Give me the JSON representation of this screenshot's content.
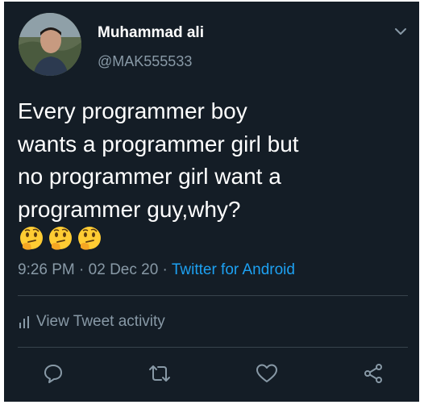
{
  "tweet": {
    "display_name": "Muhammad ali",
    "handle": "@MAK555533",
    "text_lines": [
      "Every programmer boy",
      "wants a programmer girl but",
      "no programmer girl want a",
      "programmer guy,why?"
    ],
    "emojis": [
      "thinking-face",
      "thinking-face",
      "thinking-face"
    ],
    "time": "9:26 PM",
    "separator": " · ",
    "date": "02 Dec 20",
    "source": "Twitter for Android",
    "activity_label": "View Tweet activity"
  },
  "colors": {
    "background": "#141d26",
    "text": "#ffffff",
    "muted": "#8899a6",
    "link": "#1da1f2",
    "divider": "#38444d"
  },
  "icons": {
    "menu": "chevron-down-icon",
    "activity": "bar-chart-icon",
    "reply": "reply-icon",
    "retweet": "retweet-icon",
    "like": "heart-icon",
    "share": "share-icon"
  }
}
